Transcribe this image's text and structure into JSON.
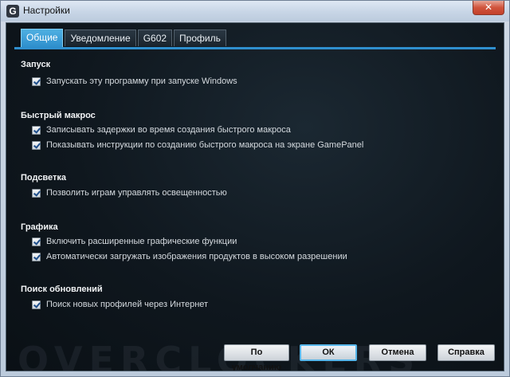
{
  "window": {
    "title": "Настройки",
    "app_icon_glyph": "G",
    "close_glyph": "✕"
  },
  "tabs": [
    {
      "label": "Общие",
      "active": true
    },
    {
      "label": "Уведомление",
      "active": false
    },
    {
      "label": "G602",
      "active": false
    },
    {
      "label": "Профиль",
      "active": false
    }
  ],
  "sections": {
    "startup": {
      "title": "Запуск",
      "options": [
        {
          "label": "Запускать эту программу при запуске Windows",
          "checked": true
        }
      ]
    },
    "macro": {
      "title": "Быстрый макрос",
      "options": [
        {
          "label": "Записывать задержки во время создания быстрого макроса",
          "checked": true
        },
        {
          "label": "Показывать инструкции по созданию быстрого макроса на экране GamePanel",
          "checked": true
        }
      ]
    },
    "lighting": {
      "title": "Подсветка",
      "options": [
        {
          "label": "Позволить играм управлять освещенностью",
          "checked": true
        }
      ]
    },
    "graphics": {
      "title": "Графика",
      "options": [
        {
          "label": "Включить расширенные графические функции",
          "checked": true
        },
        {
          "label": "Автоматически загружать изображения продуктов в высоком разрешении",
          "checked": true
        }
      ]
    },
    "updates": {
      "title": "Поиск обновлений",
      "options": [
        {
          "label": "Поиск новых профилей через Интернет",
          "checked": true
        }
      ]
    }
  },
  "buttons": {
    "defaults": "По умолчанию",
    "ok": "ОК",
    "cancel": "Отмена",
    "help": "Справка"
  },
  "watermark": "OVERCLOCKERS",
  "colors": {
    "accent": "#2f8fce",
    "tab_active": "#4fb0e2",
    "close": "#c3402a"
  }
}
